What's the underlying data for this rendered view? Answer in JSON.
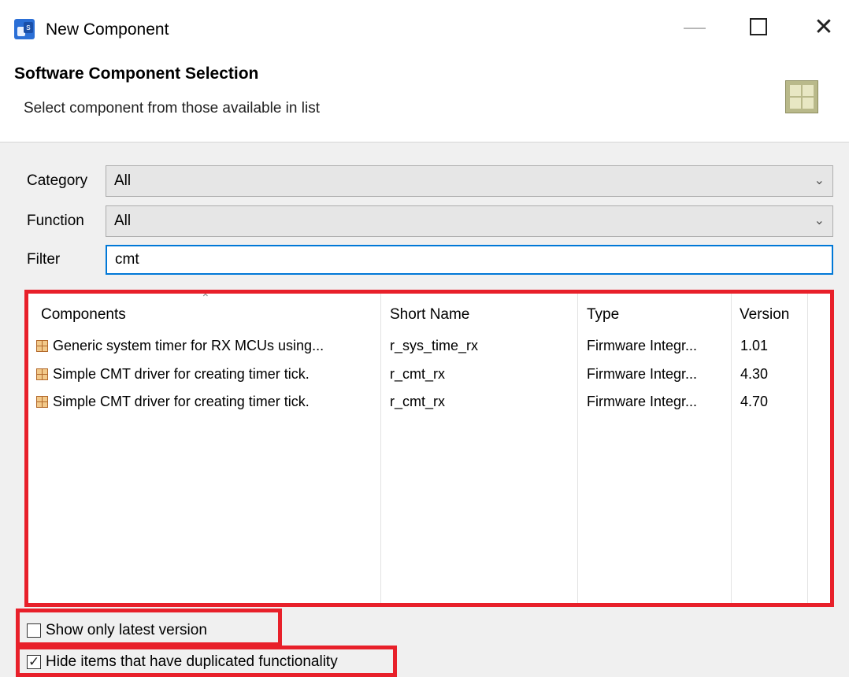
{
  "window": {
    "title": "New Component",
    "icon": "app-icon"
  },
  "header": {
    "title": "Software Component Selection",
    "subtitle": "Select component from those available in list",
    "icon": "component-grid-icon"
  },
  "form": {
    "category_label": "Category",
    "category_value": "All",
    "function_label": "Function",
    "function_value": "All",
    "filter_label": "Filter",
    "filter_value": "cmt"
  },
  "table": {
    "columns": [
      "Components",
      "Short Name",
      "Type",
      "Version"
    ],
    "rows": [
      {
        "component": "Generic system timer for RX MCUs using...",
        "short_name": "r_sys_time_rx",
        "type": "Firmware Integr...",
        "version": "1.01"
      },
      {
        "component": "Simple CMT driver for creating timer tick.",
        "short_name": "r_cmt_rx",
        "type": "Firmware Integr...",
        "version": "4.30"
      },
      {
        "component": "Simple CMT driver for creating timer tick.",
        "short_name": "r_cmt_rx",
        "type": "Firmware Integr...",
        "version": "4.70"
      }
    ]
  },
  "options": {
    "show_latest_label": "Show only latest version",
    "show_latest_checked": false,
    "hide_duplicates_label": "Hide items that have duplicated functionality",
    "hide_duplicates_checked": true
  },
  "colors": {
    "highlight": "#e8202a",
    "focus": "#0078d7"
  }
}
